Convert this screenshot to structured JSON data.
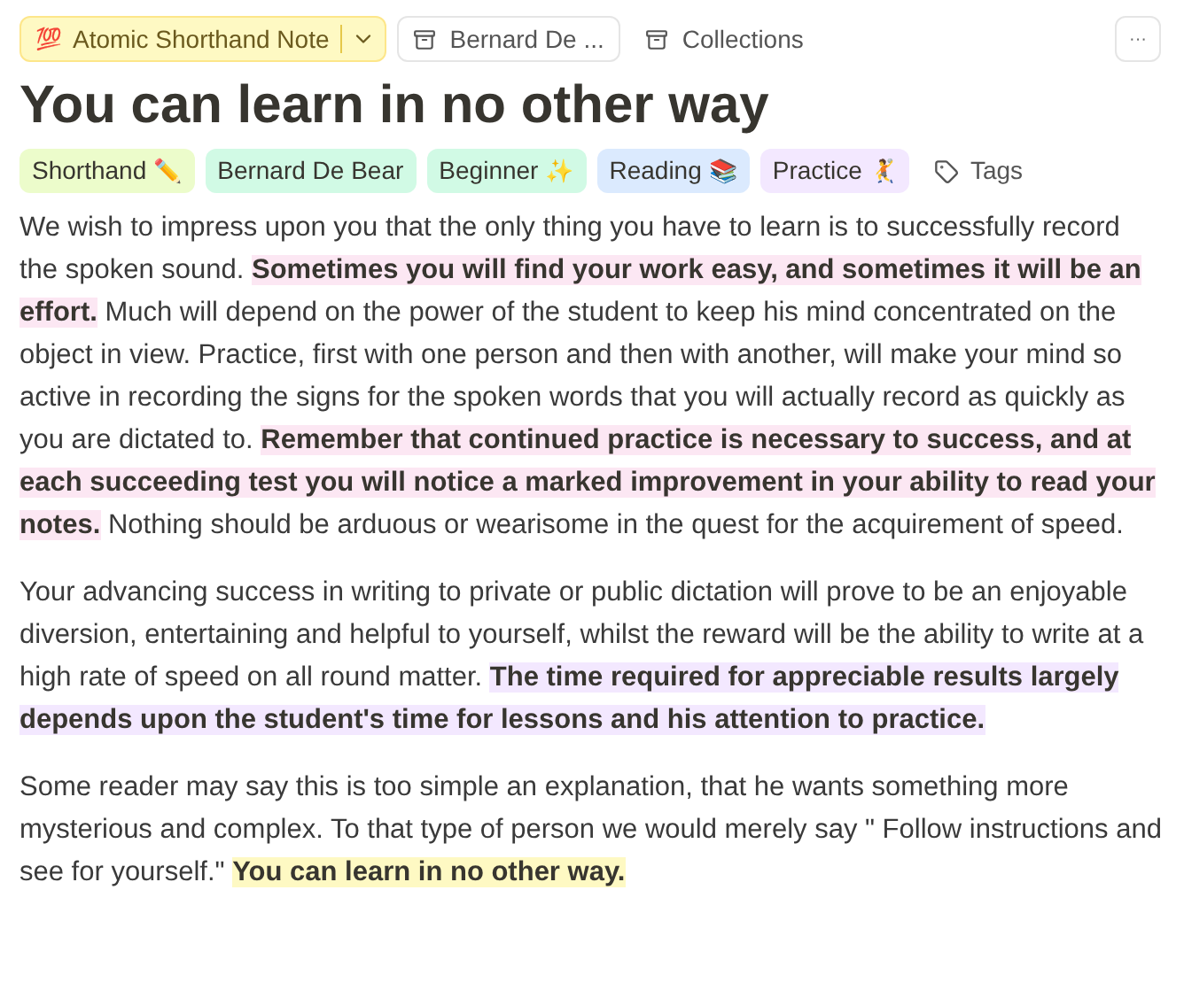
{
  "toolbar": {
    "note_type": {
      "icon": "💯",
      "label": "Atomic Shorthand Note"
    },
    "author": {
      "label": "Bernard De ..."
    },
    "collections": {
      "label": "Collections"
    },
    "more": "···"
  },
  "title": "You can learn in no other way",
  "tags": [
    {
      "label": "Shorthand",
      "emoji": "✏️",
      "color": "#ecfccb"
    },
    {
      "label": "Bernard De Bear",
      "color": "#d1fae5"
    },
    {
      "label": "Beginner",
      "emoji": "✨",
      "color": "#d1fae5"
    },
    {
      "label": "Reading",
      "emoji": "📚",
      "color": "#dbeafe"
    },
    {
      "label": "Practice",
      "emoji": "🤾",
      "color": "#f3e8ff"
    }
  ],
  "add_tag": "Tags",
  "paragraphs": [
    [
      {
        "text": "We wish to impress upon you that the only thing you have to learn is to successfully record the spoken sound. "
      },
      {
        "text": "Sometimes you will find your work easy, and sometimes it will be an effort.",
        "color": "#fce7f3"
      },
      {
        "text": " Much will depend on the power of the student to keep his mind concentrated on the object in view. Practice, first with one person and then with another, will make your mind so active in recording the signs for the spoken words that you will actually record as quickly as you are dictated to. "
      },
      {
        "text": "Remember that continued practice is necessary to success, and at each succeeding test you will notice a marked improvement in your ability to read your notes.",
        "color": "#fce7f3"
      },
      {
        "text": " Nothing should be arduous or wearisome in the quest for the acquirement of speed."
      }
    ],
    [
      {
        "text": "Your advancing success in writing to private or public dictation will prove to be an enjoyable diversion, entertaining and helpful to yourself, whilst the reward will be the ability to write at a high rate of speed on all round matter. "
      },
      {
        "text": "The time required for appreciable results largely depends upon the student's time for lessons and his attention to practice.",
        "color": "#f3e8ff"
      }
    ],
    [
      {
        "text": "Some reader may say this is too simple an explanation, that he wants something more mysterious and complex. To that type of person we would merely say \" Follow instructions and see for yourself.\" "
      },
      {
        "text": "You can learn in no other way.",
        "color": "#fef9c3"
      }
    ]
  ]
}
